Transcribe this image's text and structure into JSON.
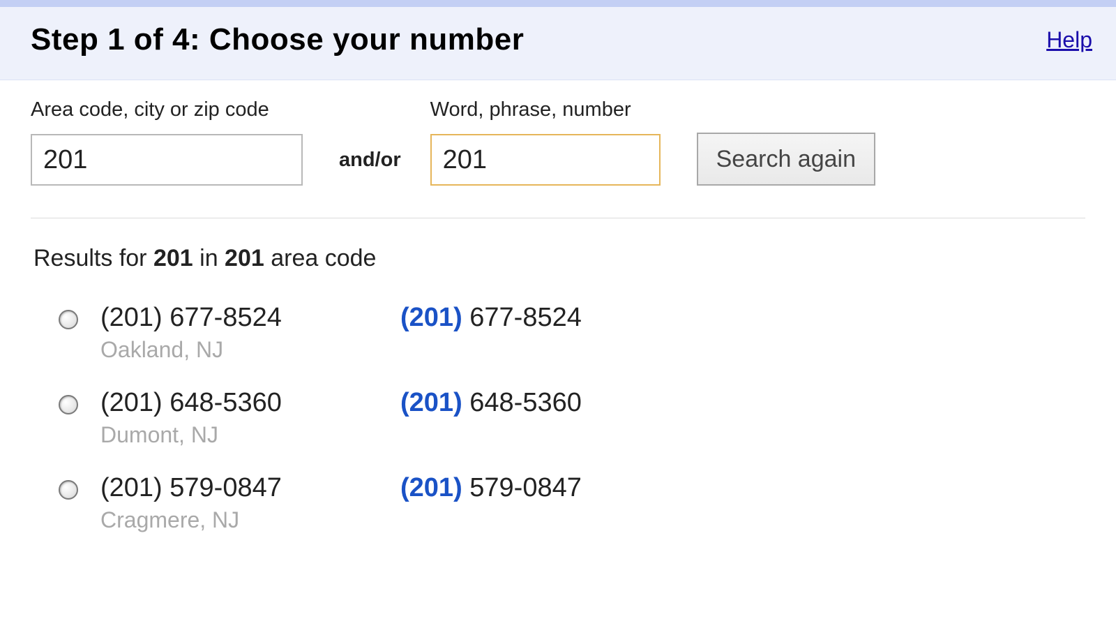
{
  "header": {
    "title": "Step 1 of 4: Choose your number",
    "help_label": "Help"
  },
  "search": {
    "area_label": "Area code, city or zip code",
    "area_value": "201",
    "conjunction": "and/or",
    "word_label": "Word, phrase, number",
    "word_value": "201",
    "button_label": "Search again"
  },
  "results": {
    "prefix": "Results for ",
    "term": "201",
    "middle": " in ",
    "area": "201",
    "suffix": " area code",
    "items": [
      {
        "plain": "(201) 677-8524",
        "hl_open": "(",
        "hl_digits": "201",
        "hl_close": ")",
        "rest": " 677-8524",
        "location": "Oakland, NJ"
      },
      {
        "plain": "(201) 648-5360",
        "hl_open": "(",
        "hl_digits": "201",
        "hl_close": ")",
        "rest": " 648-5360",
        "location": "Dumont, NJ"
      },
      {
        "plain": "(201) 579-0847",
        "hl_open": "(",
        "hl_digits": "201",
        "hl_close": ")",
        "rest": " 579-0847",
        "location": "Cragmere, NJ"
      }
    ]
  }
}
